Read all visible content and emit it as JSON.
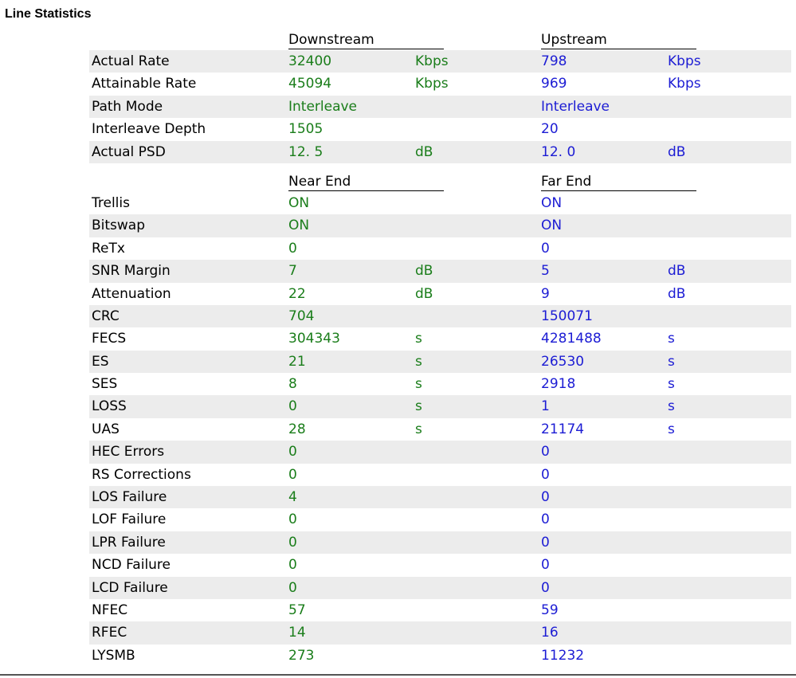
{
  "page_title": "Line Statistics",
  "section1": {
    "head_left": "Downstream",
    "head_right": "Upstream",
    "rows": [
      {
        "label": "Actual Rate",
        "down_value": "32400",
        "down_unit": "Kbps",
        "up_value": "798",
        "up_unit": "Kbps"
      },
      {
        "label": "Attainable Rate",
        "down_value": "45094",
        "down_unit": "Kbps",
        "up_value": "969",
        "up_unit": "Kbps"
      },
      {
        "label": "Path Mode",
        "down_value": "Interleave",
        "down_unit": "",
        "up_value": "Interleave",
        "up_unit": ""
      },
      {
        "label": "Interleave Depth",
        "down_value": "1505",
        "down_unit": "",
        "up_value": "20",
        "up_unit": ""
      },
      {
        "label": "Actual PSD",
        "down_value": "12. 5",
        "down_unit": "dB",
        "up_value": "12. 0",
        "up_unit": "dB"
      }
    ]
  },
  "section2": {
    "head_left": "Near End",
    "head_right": "Far End",
    "rows": [
      {
        "label": "Trellis",
        "down_value": "ON",
        "down_unit": "",
        "up_value": "ON",
        "up_unit": ""
      },
      {
        "label": "Bitswap",
        "down_value": "ON",
        "down_unit": "",
        "up_value": "ON",
        "up_unit": ""
      },
      {
        "label": "ReTx",
        "down_value": "0",
        "down_unit": "",
        "up_value": "0",
        "up_unit": ""
      },
      {
        "label": "SNR Margin",
        "down_value": "7",
        "down_unit": "dB",
        "up_value": "5",
        "up_unit": "dB"
      },
      {
        "label": "Attenuation",
        "down_value": "22",
        "down_unit": "dB",
        "up_value": "9",
        "up_unit": "dB"
      },
      {
        "label": "CRC",
        "down_value": "704",
        "down_unit": "",
        "up_value": "150071",
        "up_unit": ""
      },
      {
        "label": "FECS",
        "down_value": "304343",
        "down_unit": "s",
        "up_value": "4281488",
        "up_unit": "s"
      },
      {
        "label": "ES",
        "down_value": "21",
        "down_unit": "s",
        "up_value": "26530",
        "up_unit": "s"
      },
      {
        "label": "SES",
        "down_value": "8",
        "down_unit": "s",
        "up_value": "2918",
        "up_unit": "s"
      },
      {
        "label": "LOSS",
        "down_value": "0",
        "down_unit": "s",
        "up_value": "1",
        "up_unit": "s"
      },
      {
        "label": "UAS",
        "down_value": "28",
        "down_unit": "s",
        "up_value": "21174",
        "up_unit": "s"
      },
      {
        "label": "HEC Errors",
        "down_value": "0",
        "down_unit": "",
        "up_value": "0",
        "up_unit": ""
      },
      {
        "label": "RS Corrections",
        "down_value": "0",
        "down_unit": "",
        "up_value": "0",
        "up_unit": ""
      },
      {
        "label": "LOS Failure",
        "down_value": "4",
        "down_unit": "",
        "up_value": "0",
        "up_unit": ""
      },
      {
        "label": "LOF Failure",
        "down_value": "0",
        "down_unit": "",
        "up_value": "0",
        "up_unit": ""
      },
      {
        "label": "LPR Failure",
        "down_value": "0",
        "down_unit": "",
        "up_value": "0",
        "up_unit": ""
      },
      {
        "label": "NCD Failure",
        "down_value": "0",
        "down_unit": "",
        "up_value": "0",
        "up_unit": ""
      },
      {
        "label": "LCD Failure",
        "down_value": "0",
        "down_unit": "",
        "up_value": "0",
        "up_unit": ""
      },
      {
        "label": "NFEC",
        "down_value": "57",
        "down_unit": "",
        "up_value": "59",
        "up_unit": ""
      },
      {
        "label": "RFEC",
        "down_value": "14",
        "down_unit": "",
        "up_value": "16",
        "up_unit": ""
      },
      {
        "label": "LYSMB",
        "down_value": "273",
        "down_unit": "",
        "up_value": "11232",
        "up_unit": ""
      }
    ]
  },
  "colors": {
    "left_values": "#1a7d1a",
    "right_values": "#1c1cd4",
    "row_shade": "#ececec"
  }
}
